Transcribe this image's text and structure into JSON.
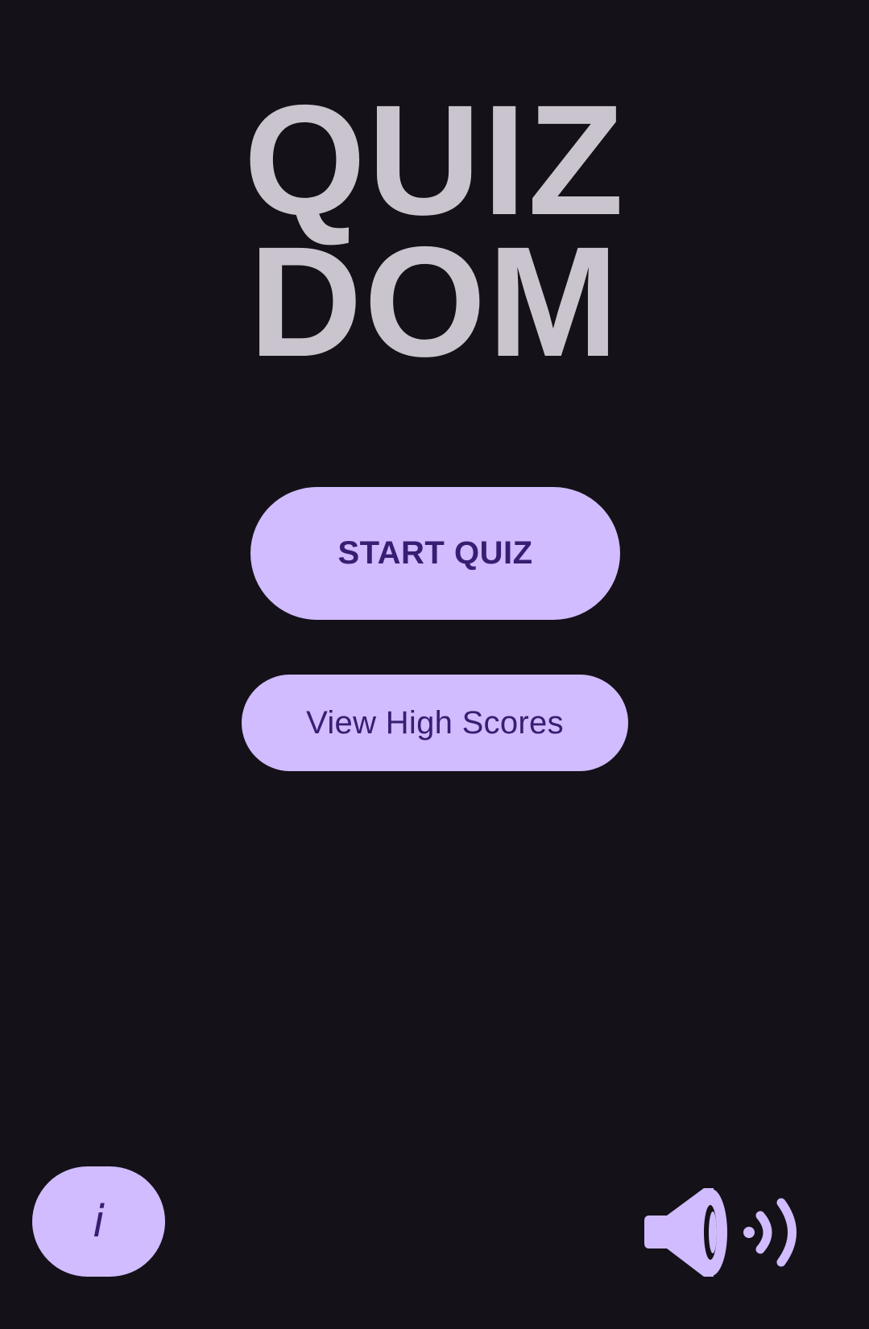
{
  "app": {
    "title_line_1": "QUIZ",
    "title_line_2": "DOM"
  },
  "menu": {
    "start_label": "START QUIZ",
    "high_scores_label": "View High Scores"
  },
  "footer": {
    "info_label": "i",
    "sound_icon": "speaker-on-icon"
  },
  "colors": {
    "background": "#141118",
    "title": "#cac4cf",
    "button_fill": "#d0bcfe",
    "button_text": "#381e72"
  }
}
